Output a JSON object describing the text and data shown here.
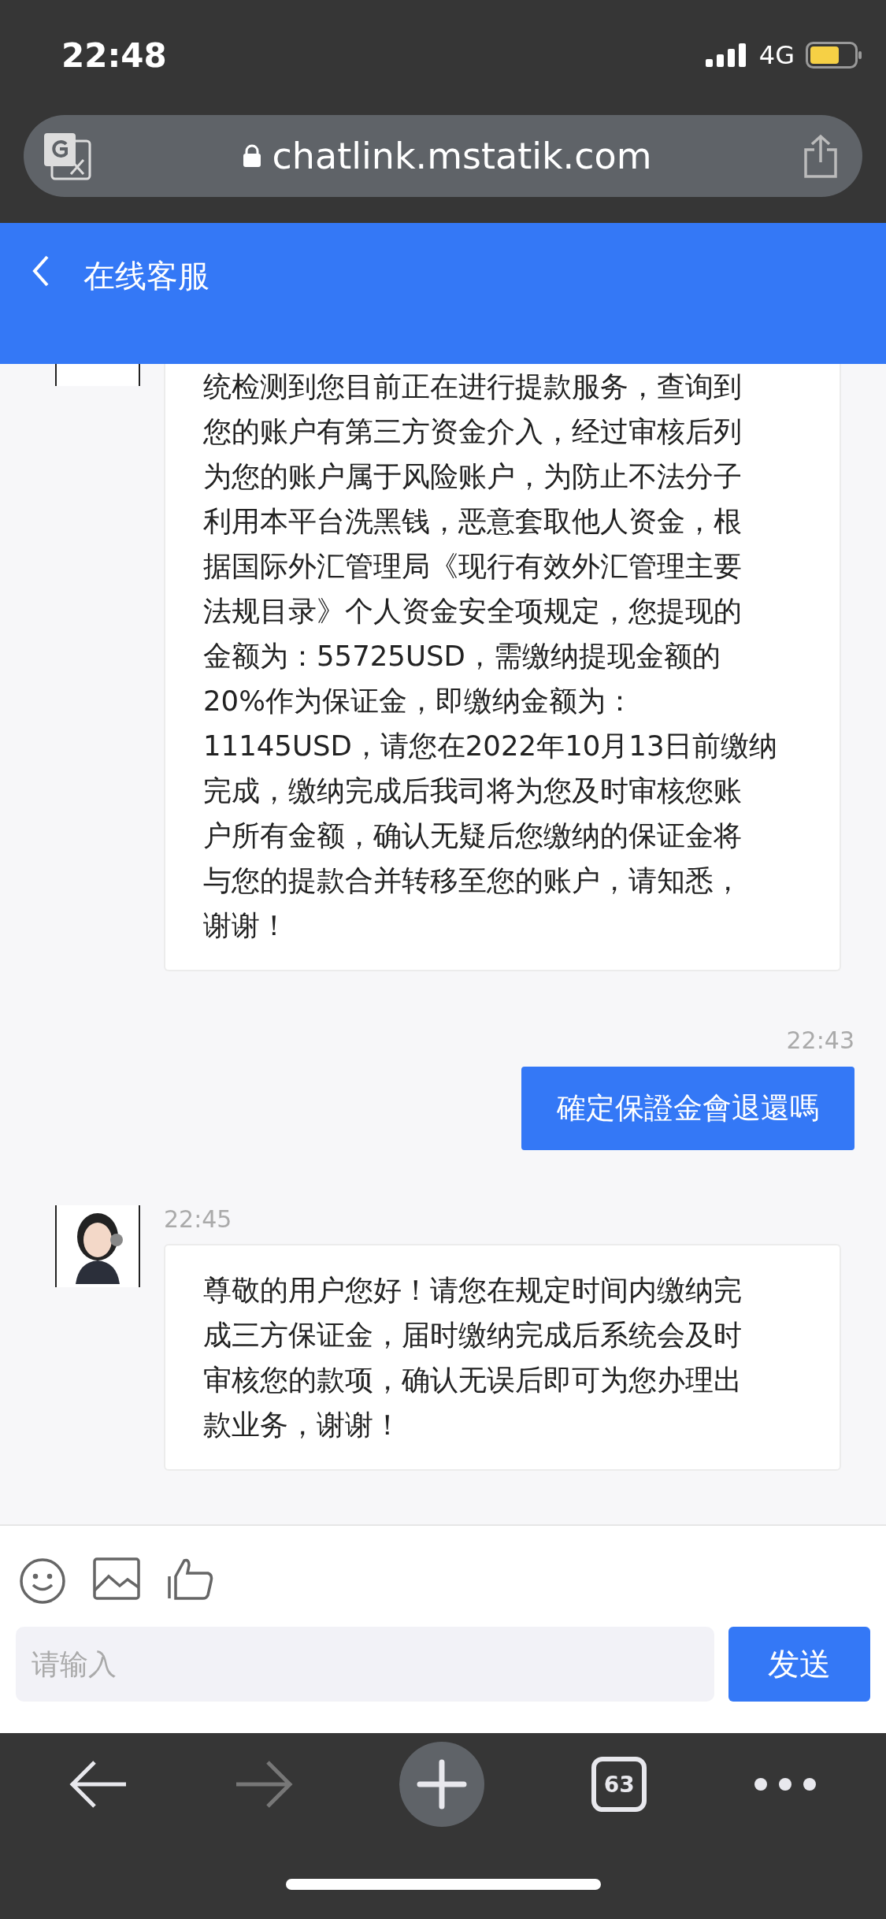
{
  "status_bar": {
    "time": "22:48",
    "network": "4G"
  },
  "browser_bar": {
    "url": "chatlink.mstatik.com"
  },
  "header": {
    "title": "在线客服"
  },
  "messages": [
    {
      "kind": "agent",
      "avatar_cut": true,
      "lines": [
        "统检测到您目前正在进行提款服务，查询到",
        "您的账户有第三方资金介入，经过审核后列",
        "为您的账户属于风险账户，为防止不法分子",
        "利用本平台洗黑钱，恶意套取他人资金，根",
        "据国际外汇管理局《现行有效外汇管理主要",
        "法规目录》个人资金安全项规定，您提现的",
        "金额为：55725USD，需缴纳提现金额的",
        "20%作为保证金，即缴纳金额为：",
        "11145USD，请您在2022年10月13日前缴纳",
        "完成，缴纳完成后我司将为您及时审核您账",
        "户所有金额，确认无疑后您缴纳的保证金将",
        "与您的提款合并转移至您的账户，请知悉，",
        "谢谢！"
      ]
    },
    {
      "kind": "user",
      "time": "22:43",
      "lines": [
        "確定保證金會退還嗎"
      ]
    },
    {
      "kind": "agent",
      "time": "22:45",
      "avatar_cut": false,
      "lines": [
        "尊敬的用户您好！请您在规定时间内缴纳完",
        "成三方保证金，届时缴纳完成后系统会及时",
        "审核您的款项，确认无误后即可为您办理出",
        "款业务，谢谢！"
      ]
    }
  ],
  "composer": {
    "placeholder": "请输入",
    "send": "发送"
  },
  "toolbar": {
    "tabs_count": "63"
  }
}
